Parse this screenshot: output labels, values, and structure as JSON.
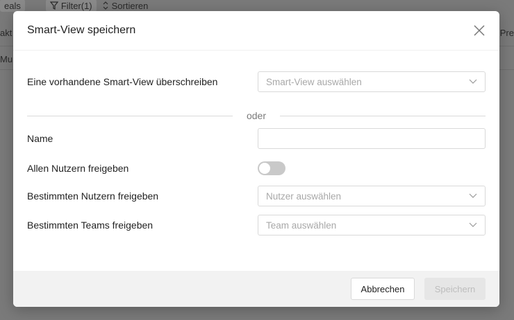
{
  "background": {
    "toolbar_deals": "eals",
    "toolbar_filter": "Filter(1)",
    "toolbar_sort": "Sortieren",
    "left_text_1": "akt",
    "left_text_2": "Mu",
    "right_text_1": "Pre"
  },
  "modal": {
    "title": "Smart-View speichern",
    "overwrite": {
      "label": "Eine vorhandene Smart-View überschreiben",
      "placeholder": "Smart-View auswählen"
    },
    "divider_text": "oder",
    "name": {
      "label": "Name",
      "value": ""
    },
    "share_all": {
      "label": "Allen Nutzern freigeben",
      "enabled": false
    },
    "share_users": {
      "label": "Bestimmten Nutzern freigeben",
      "placeholder": "Nutzer auswählen"
    },
    "share_teams": {
      "label": "Bestimmten Teams freigeben",
      "placeholder": "Team auswählen"
    },
    "footer": {
      "cancel_label": "Abbrechen",
      "save_label": "Speichern"
    }
  }
}
